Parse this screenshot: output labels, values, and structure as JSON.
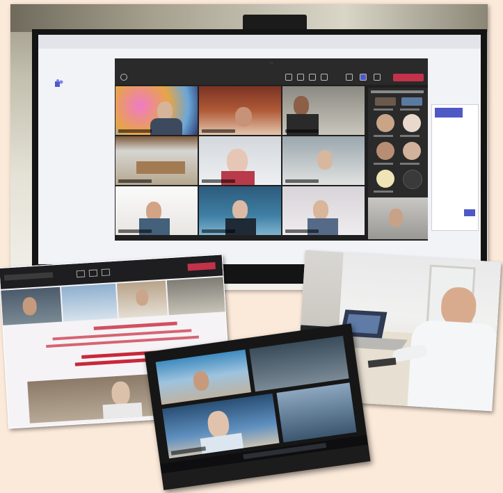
{
  "collage": {
    "background_color": "#fbe9d9",
    "photos": [
      "teams-meeting-on-monitor",
      "presentation-on-laptop-screen",
      "man-at-desk-with-laptop",
      "video-call-on-laptop"
    ]
  },
  "main_screen": {
    "app": "Microsoft Teams",
    "leave_button_color": "#c4314b",
    "video_tiles": 9,
    "participant_avatars": 6
  },
  "left_screen": {
    "text_color": "#c8283a"
  }
}
